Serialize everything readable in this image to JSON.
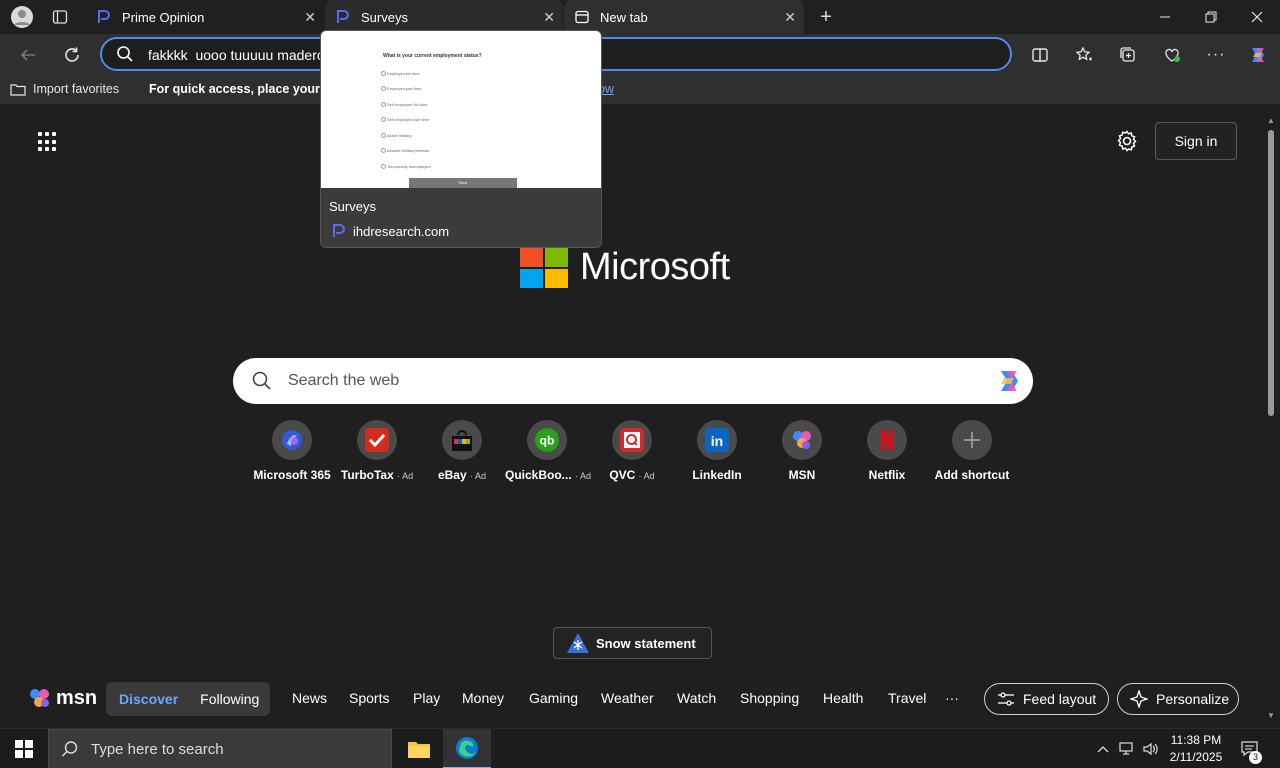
{
  "tabs": [
    {
      "label": "Prime Opinion",
      "icon": "prime-opinion-icon"
    },
    {
      "label": "Surveys",
      "icon": "surveys-icon"
    },
    {
      "label": "New tab",
      "icon": "newtab-icon"
    }
  ],
  "address_bar": {
    "value": "fakkkk  uooo tuuuuu maderch*d"
  },
  "favorites_bar": {
    "import_label": "Import favorites",
    "message": "For quick access, place your fav",
    "link_text": "ow"
  },
  "tab_preview": {
    "title": "Surveys",
    "domain": "ihdresearch.com",
    "question": "What is your current employment status?",
    "options": [
      "Employed full time",
      "Employed part time",
      "Self-employed full time",
      "Self-employed part time",
      "Active military",
      "Inactive military/Veteran",
      "Temporarily unemployed"
    ],
    "button": "Next"
  },
  "page": {
    "sign_in": "Sign in",
    "brand": "Microsoft",
    "search_placeholder": "Search the web",
    "snow_button": "Snow statement"
  },
  "shortcuts": [
    {
      "label": "Microsoft 365",
      "ad": "",
      "icon": "microsoft365-icon"
    },
    {
      "label": "TurboTax",
      "ad": "· Ad",
      "icon": "turbotax-icon"
    },
    {
      "label": "eBay",
      "ad": "· Ad",
      "icon": "ebay-icon"
    },
    {
      "label": "QuickBoo...",
      "ad": "· Ad",
      "icon": "quickbooks-icon"
    },
    {
      "label": "QVC",
      "ad": "· Ad",
      "icon": "qvc-icon"
    },
    {
      "label": "LinkedIn",
      "ad": "",
      "icon": "linkedin-icon"
    },
    {
      "label": "MSN",
      "ad": "",
      "icon": "msn-icon"
    },
    {
      "label": "Netflix",
      "ad": "",
      "icon": "netflix-icon"
    },
    {
      "label": "Add shortcut",
      "ad": "",
      "icon": "plus-icon"
    }
  ],
  "msn_bar": {
    "logo": "msn",
    "discover": "Discover",
    "following": "Following",
    "items": [
      "News",
      "Sports",
      "Play",
      "Money",
      "Gaming",
      "Weather",
      "Watch",
      "Shopping",
      "Health",
      "Travel"
    ],
    "more": "···",
    "feed_layout": "Feed layout",
    "personalize": "Personalize"
  },
  "taskbar": {
    "search_placeholder": "Type here to search",
    "time": "11:38 PM",
    "date": "2/11/2025",
    "notifications": "3"
  },
  "colors": {
    "accent": "#4c8de6",
    "link": "#6aa7ff",
    "discover": "#6ba6ff"
  }
}
